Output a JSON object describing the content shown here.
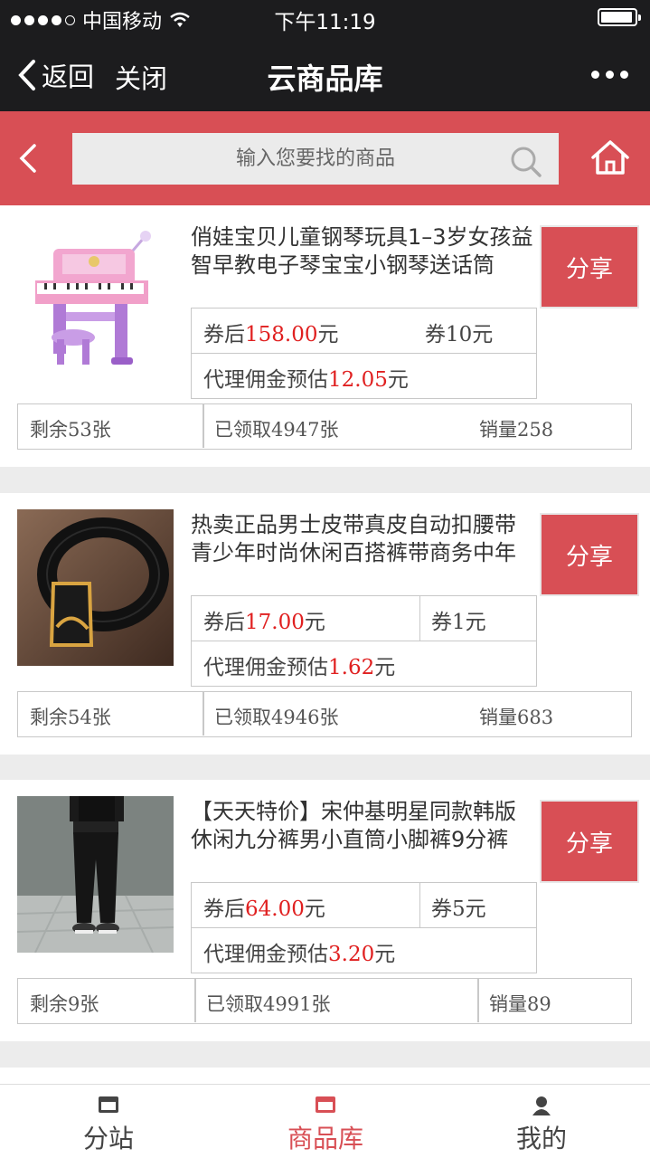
{
  "status_bar": {
    "carrier": "中国移动",
    "time": "下午11:19"
  },
  "nav": {
    "back_label": "返回",
    "close_label": "关闭",
    "title": "云商品库"
  },
  "search": {
    "placeholder": "输入您要找的商品"
  },
  "products": [
    {
      "title": "俏娃宝贝儿童钢琴玩具1–3岁女孩益智早教电子琴宝宝小钢琴送话筒",
      "share": "分享",
      "after_prefix": "券后",
      "after_price": "158.00",
      "after_unit": "元",
      "coupon": "券10元",
      "commission_prefix": "代理佣金预估",
      "commission": "12.05",
      "commission_unit": "元",
      "remaining": "剩余53张",
      "claimed": "已领取4947张",
      "sales": "销量258"
    },
    {
      "title": "热卖正品男士皮带真皮自动扣腰带青少年时尚休闲百搭裤带商务中年",
      "share": "分享",
      "after_prefix": "券后",
      "after_price": "17.00",
      "after_unit": "元",
      "coupon": "券1元",
      "commission_prefix": "代理佣金预估",
      "commission": "1.62",
      "commission_unit": "元",
      "remaining": "剩余54张",
      "claimed": "已领取4946张",
      "sales": "销量683"
    },
    {
      "title": "【天天特价】宋仲基明星同款韩版休闲九分裤男小直筒小脚裤9分裤",
      "share": "分享",
      "after_prefix": "券后",
      "after_price": "64.00",
      "after_unit": "元",
      "coupon": "券5元",
      "commission_prefix": "代理佣金预估",
      "commission": "3.20",
      "commission_unit": "元",
      "remaining": "剩余9张",
      "claimed": "已领取4991张",
      "sales": "销量89"
    }
  ],
  "tabs": [
    {
      "label": "分站",
      "icon": "store-icon"
    },
    {
      "label": "商品库",
      "icon": "store-icon",
      "active": true
    },
    {
      "label": "我的",
      "icon": "user-icon"
    }
  ],
  "colors": {
    "accent": "#d84f55",
    "price_red": "#e02020",
    "bar_dark": "#1c1c1e"
  }
}
